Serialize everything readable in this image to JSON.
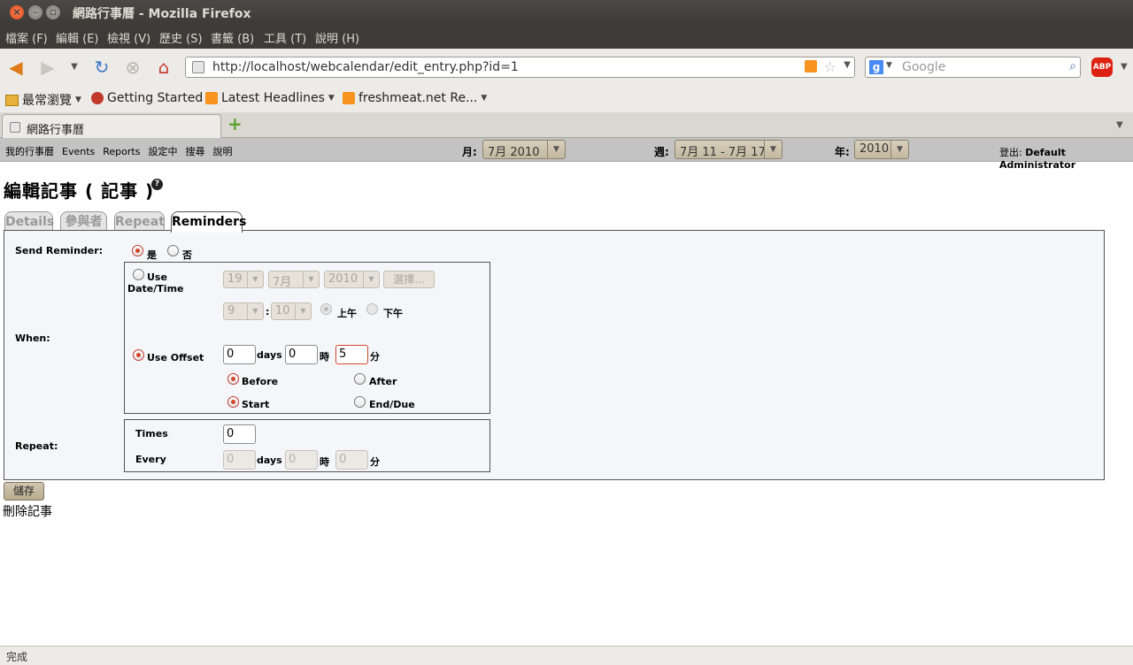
{
  "window": {
    "title": "網路行事曆 - Mozilla Firefox"
  },
  "menubar": [
    "檔案 (F)",
    "編輯 (E)",
    "檢視 (V)",
    "歷史 (S)",
    "書籤 (B)",
    "工具 (T)",
    "說明 (H)"
  ],
  "navbar": {
    "url": "http://localhost/webcalendar/edit_entry.php?id=1",
    "search_placeholder": "Google",
    "search_engine_icon": "g",
    "adblock_label": "ABP"
  },
  "bookmarks": [
    "最常瀏覽",
    "Getting Started",
    "Latest Headlines",
    "freshmeat.net Re..."
  ],
  "tabs": [
    {
      "label": "網路行事曆"
    }
  ],
  "calendar_nav": {
    "links": [
      "我的行事曆",
      "Events",
      "Reports",
      "設定中",
      "搜尋",
      "說明"
    ],
    "month_label": "月:",
    "month_value": "7月 2010",
    "week_label": "週:",
    "week_value": "7月 11 - 7月 17",
    "year_label": "年:",
    "year_value": "2010",
    "logout_label": "登出:",
    "user": "Default Administrator"
  },
  "heading": "編輯記事 ( 記事 )",
  "help_icon_glyph": "?",
  "entry_tabs": [
    "Details",
    "參與者",
    "Repeat",
    "Reminders"
  ],
  "reminders": {
    "send_reminder_label": "Send Reminder:",
    "yes_label": "是",
    "no_label": "否",
    "when_label": "When:",
    "use_datetime_label": "Use Date/Time",
    "date_day": "19",
    "date_month": "7月",
    "date_year": "2010",
    "select_button": "選擇...",
    "time_hour": "9",
    "time_sep": ":",
    "time_minute": "10",
    "am_label": "上午",
    "pm_label": "下午",
    "use_offset_label": "Use Offset",
    "offset_days": "0",
    "days_label": "days",
    "offset_hours": "0",
    "hours_label": "時",
    "offset_minutes": "5",
    "minutes_label": "分",
    "before_label": "Before",
    "after_label": "After",
    "start_label": "Start",
    "end_label": "End/Due",
    "repeat_label": "Repeat:",
    "times_label": "Times",
    "times_value": "0",
    "every_label": "Every",
    "every_days": "0",
    "every_hours": "0",
    "every_minutes": "0"
  },
  "save_button": "儲存",
  "delete_link": "刪除記事",
  "status": "完成"
}
